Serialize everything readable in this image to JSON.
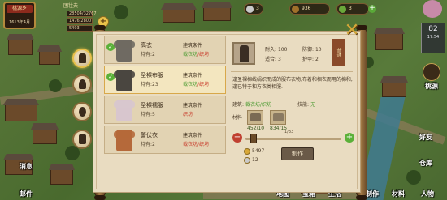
{
  "hud": {
    "player_name": "团壮夫",
    "portrait_title": "桃源乡",
    "date": "1613年4月",
    "stats": [
      "28504/32767",
      "1476/2800",
      "5493"
    ],
    "coins": "3",
    "wood": "936",
    "stone": "3",
    "weather_temp": "82",
    "weather_label": "17:54"
  },
  "side_menu": [
    "桃源",
    "建筑",
    "好友",
    "仓库",
    "人物"
  ],
  "bottom_menu": [
    "消息",
    "邮件",
    "地图",
    "宝箱",
    "生活",
    "制作",
    "材料"
  ],
  "items": [
    {
      "name": "高衣",
      "own": "持有:2",
      "req": "建筑条件",
      "req2": "裁衣坊/织坊",
      "color": "#6f6a62"
    },
    {
      "name": "圣裸布服",
      "own": "持有:23",
      "req": "建筑条件",
      "req2": "裁衣坊/织坊",
      "color": "#4a4640"
    },
    {
      "name": "圣裸襦服",
      "own": "持有:5",
      "req": "建筑条件",
      "req2": "织坊",
      "color": "#d8c6ce"
    },
    {
      "name": "警伏衣",
      "own": "持有:2",
      "req": "建筑条件",
      "req2": "裁衣坊/织坊",
      "color": "#b5693a"
    }
  ],
  "detail": {
    "stat1_label": "耐久:",
    "stat1_val": "100",
    "stat2_label": "防御:",
    "stat2_val": "10",
    "stat3_label": "适合:",
    "stat3_val": "3",
    "stat4_label": "护甲:",
    "stat4_val": "2",
    "tag": "普通",
    "description": "逢圣裸棉线绢织而成的服布衣物,布着和相衣而用的棉和,逢已特于和方衣类相服.",
    "building_label": "建筑:",
    "building_value": "裁衣坊/织坊",
    "tech_label": "技能:",
    "tech_value": "无",
    "materials_label": "材料",
    "mat1_count": "452/10",
    "mat2_count": "834/15",
    "ratio": "1/33",
    "cost1": "5497",
    "cost2": "12"
  },
  "make_label": "制作"
}
